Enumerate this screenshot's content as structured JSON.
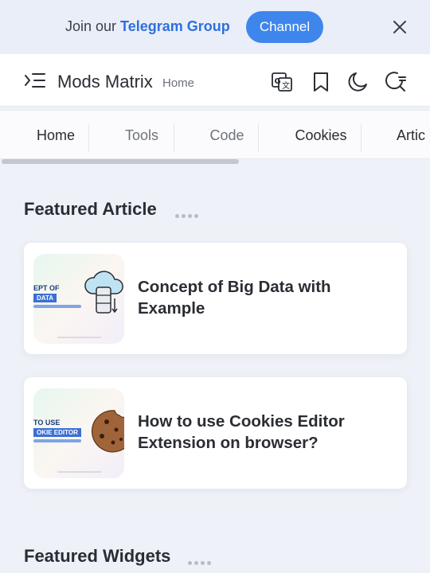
{
  "topbar": {
    "prefix": "Join our ",
    "link_text": "Telegram Group",
    "button_label": "Channel"
  },
  "header": {
    "brand": "Mods Matrix",
    "breadcrumb": "Home"
  },
  "nav": {
    "tabs": [
      "Home",
      "Tools",
      "Code",
      "Cookies",
      "Artic"
    ]
  },
  "sections": {
    "featured_article": "Featured Article",
    "featured_widgets": "Featured Widgets"
  },
  "articles": [
    {
      "title": "Concept of Big Data with Example",
      "thumb_line1": "EPT OF",
      "thumb_line2": "DATA"
    },
    {
      "title": "How to use Cookies Editor Extension on browser?",
      "thumb_line1": "TO USE",
      "thumb_line2": "OKIE EDITOR"
    }
  ],
  "colors": {
    "accent": "#3f86ec",
    "link": "#2f6fdc"
  }
}
